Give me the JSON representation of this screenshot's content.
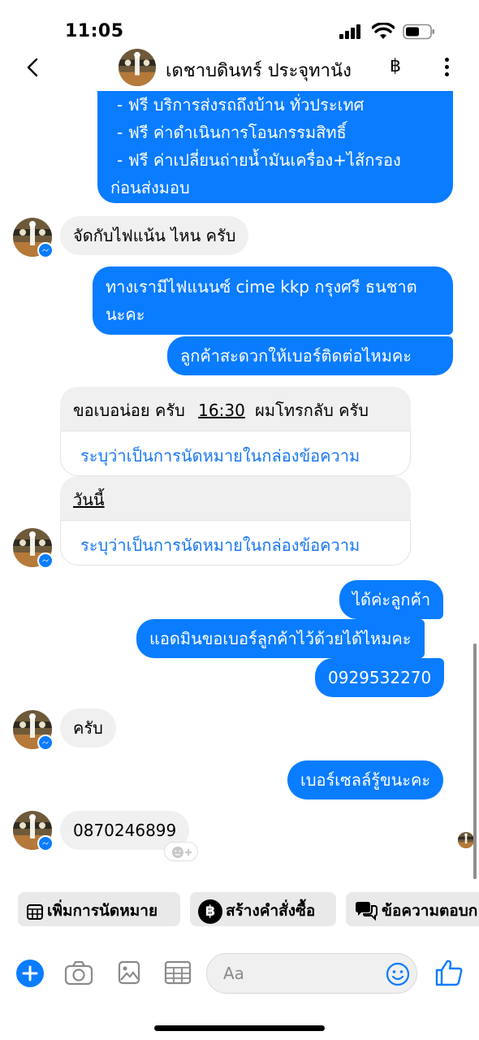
{
  "status": {
    "time": "11:05"
  },
  "header": {
    "contact_name": "เดชาบดินทร์ ประจุทานัง",
    "baht_symbol": "฿"
  },
  "messages": {
    "m1_line1": "- ฟรี บริการส่งรถถึงบ้าน ทั่วประเทศ",
    "m1_line2": "- ฟรี ค่าดำเนินการโอนกรรมสิทธิ์",
    "m1_line3": "- ฟรี ค่าเปลี่ยนถ่ายน้ำมันเครื่อง+ไส้กรอง",
    "m1_line4": "ก่อนส่งมอบ",
    "m2": "จัดกับไฟแน้น ไหน ครับ",
    "m3_line1": "ทางเรามีไฟแนนซ์ cime kkp กรุงศรี ธนชาต",
    "m3_line2": "นะคะ",
    "m4": "ลูกค้าสะดวกให้เบอร์ติดต่อไหมคะ",
    "m5_pre": "ขอเบอน่อย ครับ",
    "m5_time": "16:30",
    "m5_post": "ผมโทรกลับ ครับ",
    "m6_today": "วันนี้",
    "m7": "ได้ค่ะลูกค้า",
    "m8": "แอดมินขอเบอร์ลูกค้าไว้ด้วยได้ไหมคะ",
    "m9": "0929532270",
    "m10": "ครับ",
    "m11": "เบอร์เซลล์รู้ขนะคะ",
    "m12": "0870246899",
    "appointment_prompt": "ระบุว่าเป็นการนัดหมายในกล่องข้อความ"
  },
  "quick_actions": {
    "appointment": "เพิ่มการนัดหมาย",
    "order": "สร้างคำสั่งซื้อ",
    "saved_reply": "ข้อความตอบก"
  },
  "composer": {
    "placeholder": "Aa"
  },
  "colors": {
    "accent": "#0a7cff",
    "incoming": "#f0f0f0",
    "link": "#1877f2"
  },
  "icons": [
    "back-icon",
    "more-icon",
    "messenger-icon",
    "add-reaction-icon",
    "calendar-icon",
    "baht-icon",
    "chat-bubbles-icon",
    "plus-icon",
    "camera-icon",
    "image-icon",
    "calendar-grid-icon",
    "emoji-icon",
    "thumbs-up-icon"
  ]
}
